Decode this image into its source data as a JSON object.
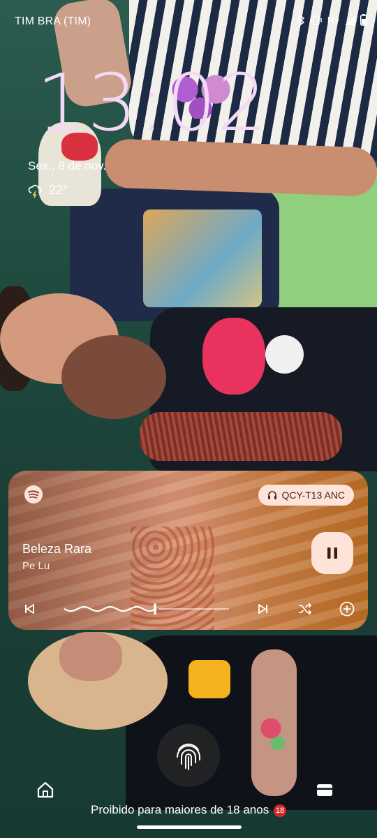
{
  "status_bar": {
    "carrier": "TIM BRA (TIM)",
    "network": "H+",
    "icons": [
      "bluetooth-icon",
      "vibrate-icon",
      "signal-icon",
      "battery-icon"
    ]
  },
  "lockscreen": {
    "time": "13:02",
    "date": "Sex., 8 de nov.",
    "weather": {
      "icon": "thunderstorm-icon",
      "temperature": "22°"
    }
  },
  "media": {
    "app_icon": "spotify-icon",
    "output_device": "QCY-T13 ANC",
    "track_title": "Beleza Rara",
    "artist": "Pe Lu",
    "state": "playing",
    "progress": 0.55,
    "controls": [
      "previous-icon",
      "pause-icon",
      "next-icon",
      "shuffle-icon",
      "add-icon"
    ],
    "accent": "#fde3d8"
  },
  "footer": {
    "notice": "Proibido para maiores de 18 anos",
    "rating": "18"
  },
  "colors": {
    "clock": "#f3d9f6",
    "card_bg": "#c8886a"
  }
}
